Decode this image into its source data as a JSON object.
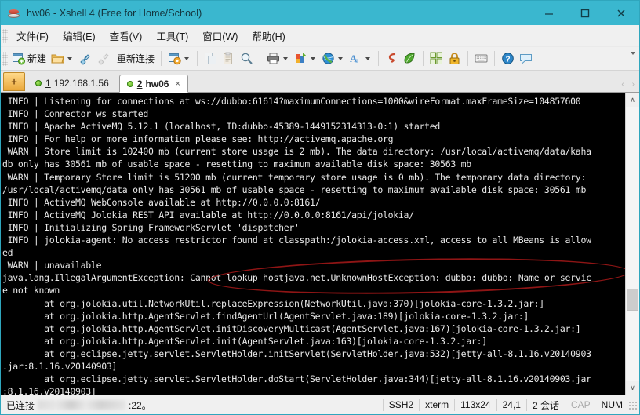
{
  "window": {
    "title": "hw06 - Xshell 4 (Free for Home/School)",
    "titlebar_color": "#3ab7cf",
    "minimize_label": "—",
    "maximize_label": "☐",
    "close_label": "✕"
  },
  "menubar": {
    "items": [
      {
        "label": "文件(F)",
        "name": "menu-file"
      },
      {
        "label": "编辑(E)",
        "name": "menu-edit"
      },
      {
        "label": "查看(V)",
        "name": "menu-view"
      },
      {
        "label": "工具(T)",
        "name": "menu-tools"
      },
      {
        "label": "窗口(W)",
        "name": "menu-window"
      },
      {
        "label": "帮助(H)",
        "name": "menu-help"
      }
    ]
  },
  "toolbar": {
    "new_label": "新建",
    "reconnect_label": "重新连接",
    "overflow_label": "▾"
  },
  "tabs": {
    "new_tab_plus": "+",
    "items": [
      {
        "num": "1",
        "title": "192.168.1.56",
        "active": false
      },
      {
        "num": "2",
        "title": "hw06",
        "active": true
      }
    ],
    "close_glyph": "×",
    "scroll_left": "‹",
    "scroll_right": "›"
  },
  "terminal": {
    "background": "#000000",
    "foreground": "#e8e8e8",
    "lines": [
      " INFO | Listening for connections at ws://dubbo:61614?maximumConnections=1000&wireFormat.maxFrameSize=104857600",
      " INFO | Connector ws started",
      " INFO | Apache ActiveMQ 5.12.1 (localhost, ID:dubbo-45389-1449152314313-0:1) started",
      " INFO | For help or more information please see: http://activemq.apache.org",
      " WARN | Store limit is 102400 mb (current store usage is 2 mb). The data directory: /usr/local/activemq/data/kaha",
      "db only has 30561 mb of usable space - resetting to maximum available disk space: 30563 mb",
      " WARN | Temporary Store limit is 51200 mb (current temporary store usage is 0 mb). The temporary data directory:",
      "/usr/local/activemq/data only has 30561 mb of usable space - resetting to maximum available disk space: 30561 mb",
      " INFO | ActiveMQ WebConsole available at http://0.0.0.0:8161/",
      " INFO | ActiveMQ Jolokia REST API available at http://0.0.0.0:8161/api/jolokia/",
      " INFO | Initializing Spring FrameworkServlet 'dispatcher'",
      " INFO | jolokia-agent: No access restrictor found at classpath:/jolokia-access.xml, access to all MBeans is allow",
      "ed",
      " WARN | unavailable",
      "java.lang.IllegalArgumentException: Cannot lookup hostjava.net.UnknownHostException: dubbo: dubbo: Name or servic",
      "e not known",
      "        at org.jolokia.util.NetworkUtil.replaceExpression(NetworkUtil.java:370)[jolokia-core-1.3.2.jar:]",
      "        at org.jolokia.http.AgentServlet.findAgentUrl(AgentServlet.java:189)[jolokia-core-1.3.2.jar:]",
      "        at org.jolokia.http.AgentServlet.initDiscoveryMulticast(AgentServlet.java:167)[jolokia-core-1.3.2.jar:]",
      "        at org.jolokia.http.AgentServlet.init(AgentServlet.java:163)[jolokia-core-1.3.2.jar:]",
      "        at org.eclipse.jetty.servlet.ServletHolder.initServlet(ServletHolder.java:532)[jetty-all-8.1.16.v20140903",
      ".jar:8.1.16.v20140903]",
      "        at org.eclipse.jetty.servlet.ServletHolder.doStart(ServletHolder.java:344)[jetty-all-8.1.16.v20140903.jar",
      ":8.1.16.v20140903]"
    ],
    "annotation": {
      "shape": "ellipse",
      "color": "#8f1515",
      "covers_text": "Cannot lookup hostjava.net.UnknownHostException: dubbo: dubbo: Name or service not known"
    }
  },
  "scrollbar": {
    "up_arrow": "∧",
    "down_arrow": "∨"
  },
  "statusbar": {
    "connected_label": "已连接",
    "host_redacted": "",
    "port_label": ":22。",
    "protocol": "SSH2",
    "terminal_type": "xterm",
    "size": "113x24",
    "cursor": "24,1",
    "sessions": "2 会话",
    "cap": "CAP",
    "num": "NUM"
  }
}
